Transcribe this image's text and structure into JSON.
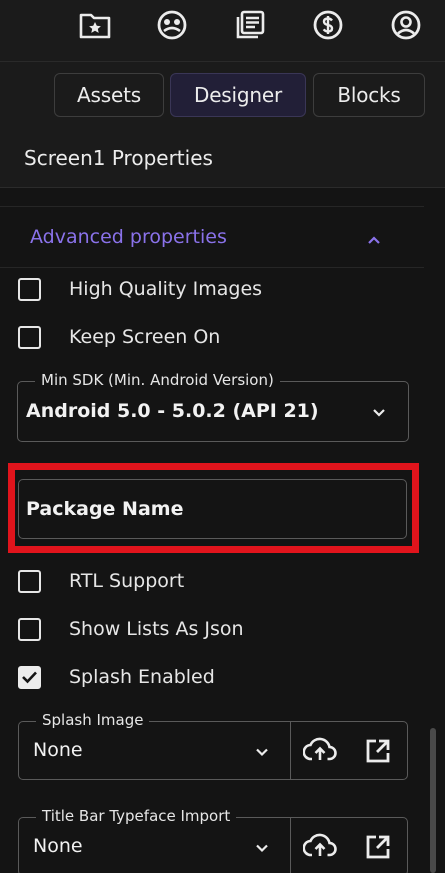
{
  "toolbar": {
    "icons": [
      "folder-star-icon",
      "gallery-icon",
      "news-icon",
      "dollar-icon",
      "account-icon"
    ]
  },
  "tabs": [
    {
      "label": "Assets"
    },
    {
      "label": "Designer",
      "active": true
    },
    {
      "label": "Blocks"
    }
  ],
  "panel": {
    "title": "Screen1 Properties",
    "advanced_label": "Advanced properties"
  },
  "properties": {
    "high_quality_images": {
      "label": "High Quality Images",
      "checked": false
    },
    "keep_screen_on": {
      "label": "Keep Screen On",
      "checked": false
    },
    "min_sdk": {
      "label": "Min SDK (Min. Android Version)",
      "value": "Android 5.0 - 5.0.2 (API 21)"
    },
    "package_name": {
      "value": "Package Name"
    },
    "rtl_support": {
      "label": "RTL Support",
      "checked": false
    },
    "show_lists_as_json": {
      "label": "Show Lists As Json",
      "checked": false
    },
    "splash_enabled": {
      "label": "Splash Enabled",
      "checked": true
    },
    "splash_image": {
      "label": "Splash Image",
      "value": "None"
    },
    "title_bar_typeface": {
      "label": "Title Bar Typeface Import",
      "value": "None"
    }
  },
  "colors": {
    "accent": "#8a72ea",
    "highlight": "#e0141c",
    "background": "#141414"
  }
}
